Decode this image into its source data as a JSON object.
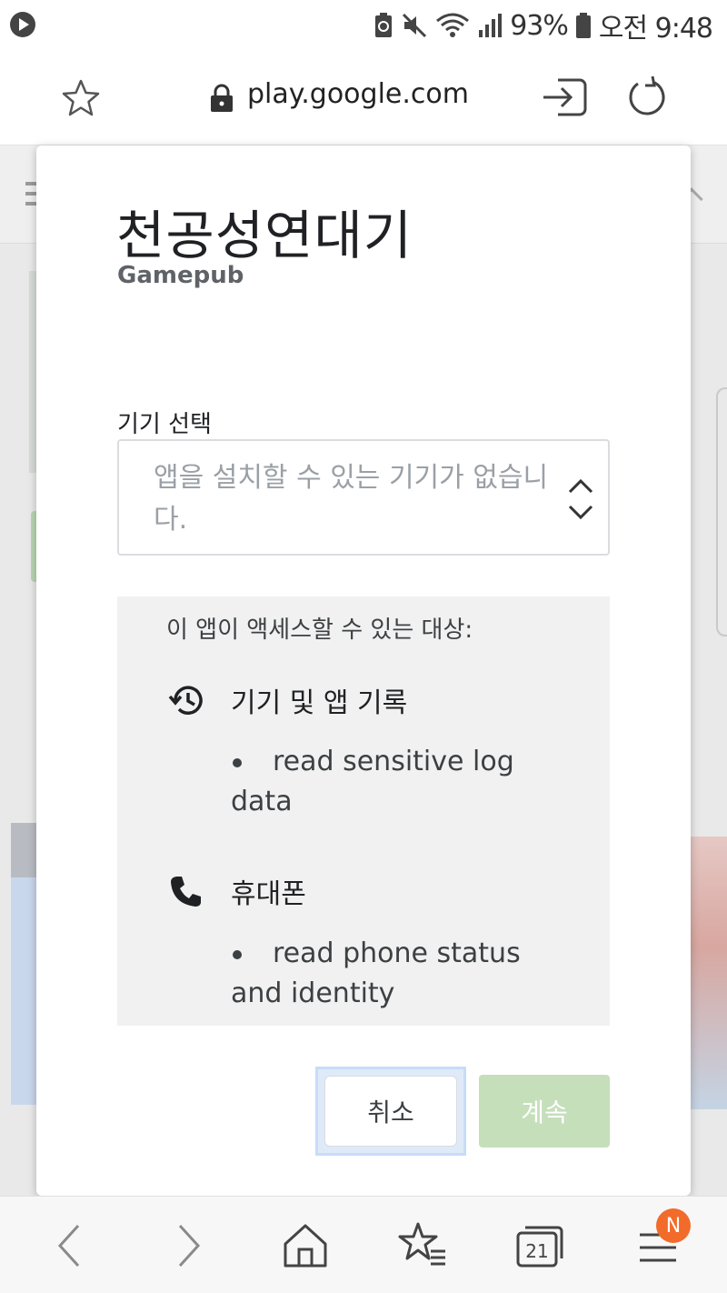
{
  "status_bar": {
    "battery_percent": "93%",
    "time": "오전 9:48"
  },
  "browser": {
    "url": "play.google.com"
  },
  "dialog": {
    "app_title": "천공성연대기",
    "developer": "Gamepub",
    "device_label": "기기 선택",
    "device_placeholder": "앱을 설치할 수 있는 기기가 없습니다.",
    "permissions_heading": "이 앱이 액세스할 수 있는 대상:",
    "permissions": [
      {
        "icon": "history-icon",
        "title": "기기 및 앱 기록",
        "items": [
          "read sensitive log data"
        ]
      },
      {
        "icon": "phone-icon",
        "title": "휴대폰",
        "items": [
          "read phone status and identity"
        ]
      }
    ],
    "cancel_label": "취소",
    "continue_label": "계속"
  },
  "bottom_nav": {
    "tabs_count": "21",
    "menu_badge": "N"
  },
  "colors": {
    "continue_disabled": "#c5dfbb",
    "badge": "#f26b2a",
    "focus_ring": "#c7dcf7"
  }
}
